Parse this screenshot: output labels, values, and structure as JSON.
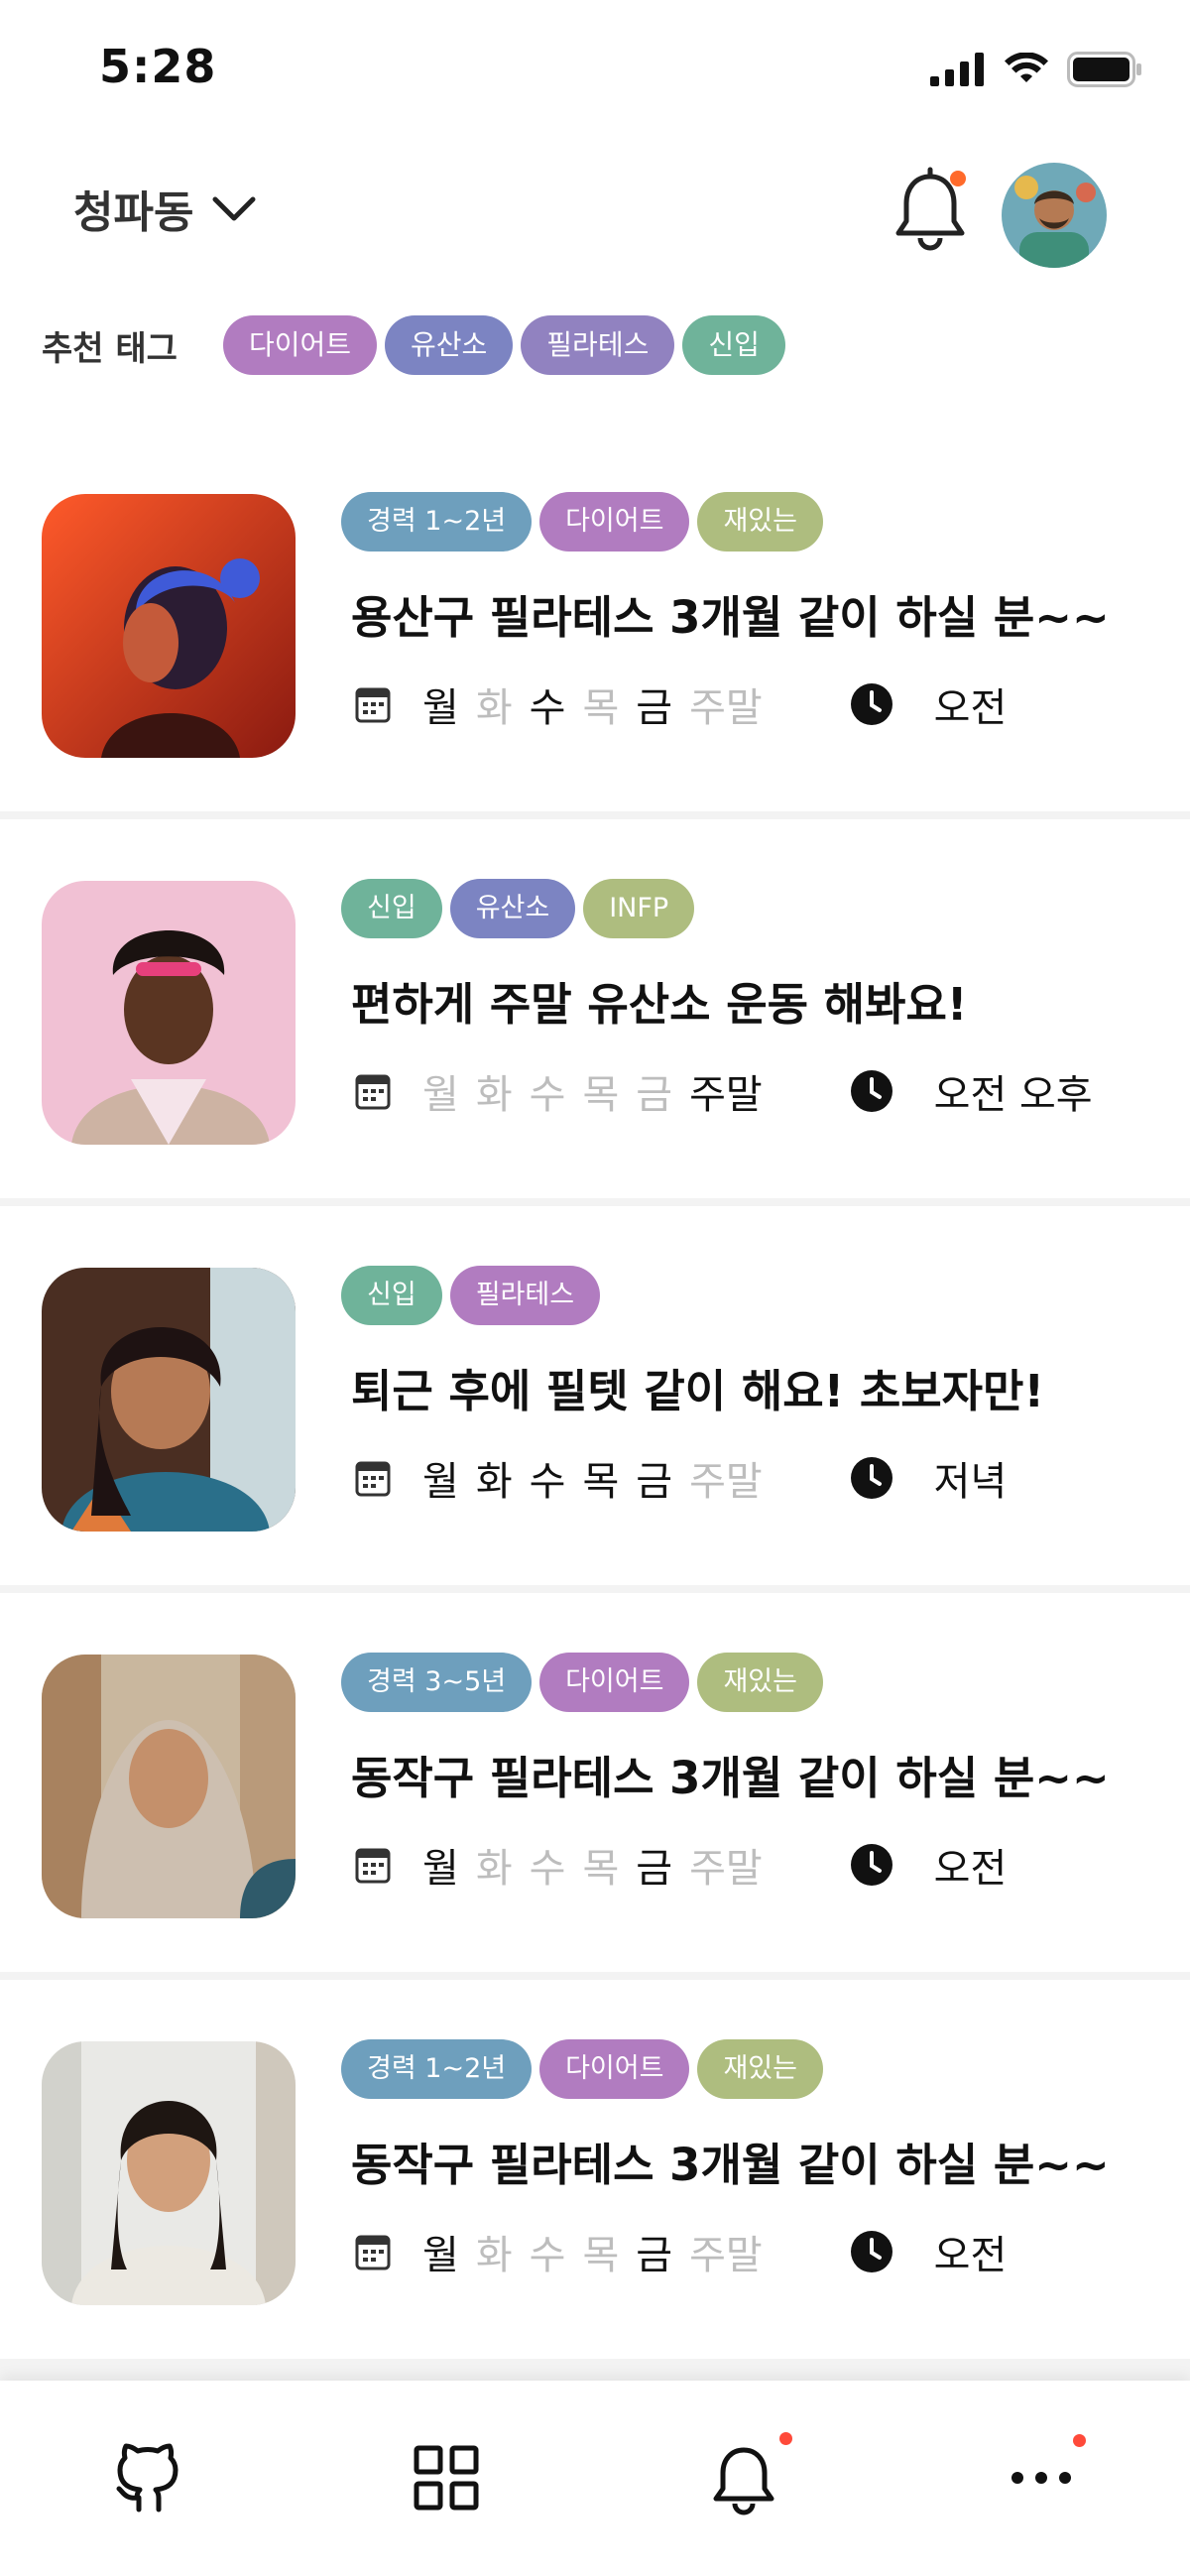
{
  "status_bar": {
    "time": "5:28"
  },
  "header": {
    "location": "청파동"
  },
  "recommended": {
    "title": "추천 태그",
    "tags": [
      {
        "label": "다이어트",
        "color": "#b17cc0"
      },
      {
        "label": "유산소",
        "color": "#7c84c2"
      },
      {
        "label": "필라테스",
        "color": "#9182c0"
      },
      {
        "label": "신입",
        "color": "#6fb39a"
      }
    ]
  },
  "posts": [
    {
      "tags": [
        {
          "label": "경력 1~2년",
          "color": "#6e9fbd"
        },
        {
          "label": "다이어트",
          "color": "#b17cc0"
        },
        {
          "label": "재있는",
          "color": "#aebd7f"
        }
      ],
      "title": "용산구 필라테스 3개월 같이 하실 분~~",
      "days": [
        {
          "label": "월",
          "active": true
        },
        {
          "label": "화",
          "active": false
        },
        {
          "label": "수",
          "active": true
        },
        {
          "label": "목",
          "active": false
        },
        {
          "label": "금",
          "active": true
        },
        {
          "label": "주말",
          "active": false
        }
      ],
      "times": "오전"
    },
    {
      "tags": [
        {
          "label": "신입",
          "color": "#6fb39a"
        },
        {
          "label": "유산소",
          "color": "#7c84c2"
        },
        {
          "label": "INFP",
          "color": "#aebd7f"
        }
      ],
      "title": "편하게 주말 유산소 운동 해봐요!",
      "days": [
        {
          "label": "월",
          "active": false
        },
        {
          "label": "화",
          "active": false
        },
        {
          "label": "수",
          "active": false
        },
        {
          "label": "목",
          "active": false
        },
        {
          "label": "금",
          "active": false
        },
        {
          "label": "주말",
          "active": true
        }
      ],
      "times": "오전 오후"
    },
    {
      "tags": [
        {
          "label": "신입",
          "color": "#6fb39a"
        },
        {
          "label": "필라테스",
          "color": "#b17cc0"
        }
      ],
      "title": "퇴근 후에 필텟 같이 해요! 초보자만!",
      "days": [
        {
          "label": "월",
          "active": true
        },
        {
          "label": "화",
          "active": true
        },
        {
          "label": "수",
          "active": true
        },
        {
          "label": "목",
          "active": true
        },
        {
          "label": "금",
          "active": true
        },
        {
          "label": "주말",
          "active": false
        }
      ],
      "times": "저녁"
    },
    {
      "tags": [
        {
          "label": "경력 3~5년",
          "color": "#6e9fbd"
        },
        {
          "label": "다이어트",
          "color": "#b17cc0"
        },
        {
          "label": "재있는",
          "color": "#aebd7f"
        }
      ],
      "title": "동작구 필라테스 3개월 같이 하실 분~~",
      "days": [
        {
          "label": "월",
          "active": true
        },
        {
          "label": "화",
          "active": false
        },
        {
          "label": "수",
          "active": false
        },
        {
          "label": "목",
          "active": false
        },
        {
          "label": "금",
          "active": true
        },
        {
          "label": "주말",
          "active": false
        }
      ],
      "times": "오전"
    },
    {
      "tags": [
        {
          "label": "경력 1~2년",
          "color": "#6e9fbd"
        },
        {
          "label": "다이어트",
          "color": "#b17cc0"
        },
        {
          "label": "재있는",
          "color": "#aebd7f"
        }
      ],
      "title": "동작구 필라테스 3개월 같이 하실 분~~",
      "days": [
        {
          "label": "월",
          "active": true
        },
        {
          "label": "화",
          "active": false
        },
        {
          "label": "수",
          "active": false
        },
        {
          "label": "목",
          "active": false
        },
        {
          "label": "금",
          "active": true
        },
        {
          "label": "주말",
          "active": false
        }
      ],
      "times": "오전"
    }
  ],
  "bottom_nav": [
    {
      "icon": "github-icon",
      "has_badge": false
    },
    {
      "icon": "grid-icon",
      "has_badge": false
    },
    {
      "icon": "bell-icon",
      "has_badge": true
    },
    {
      "icon": "more-icon",
      "has_badge": true
    }
  ],
  "colors": {
    "badge": "#ff4a3a",
    "inactive_day": "#bdbdbd",
    "accent_dot": "#ff6a2b"
  }
}
